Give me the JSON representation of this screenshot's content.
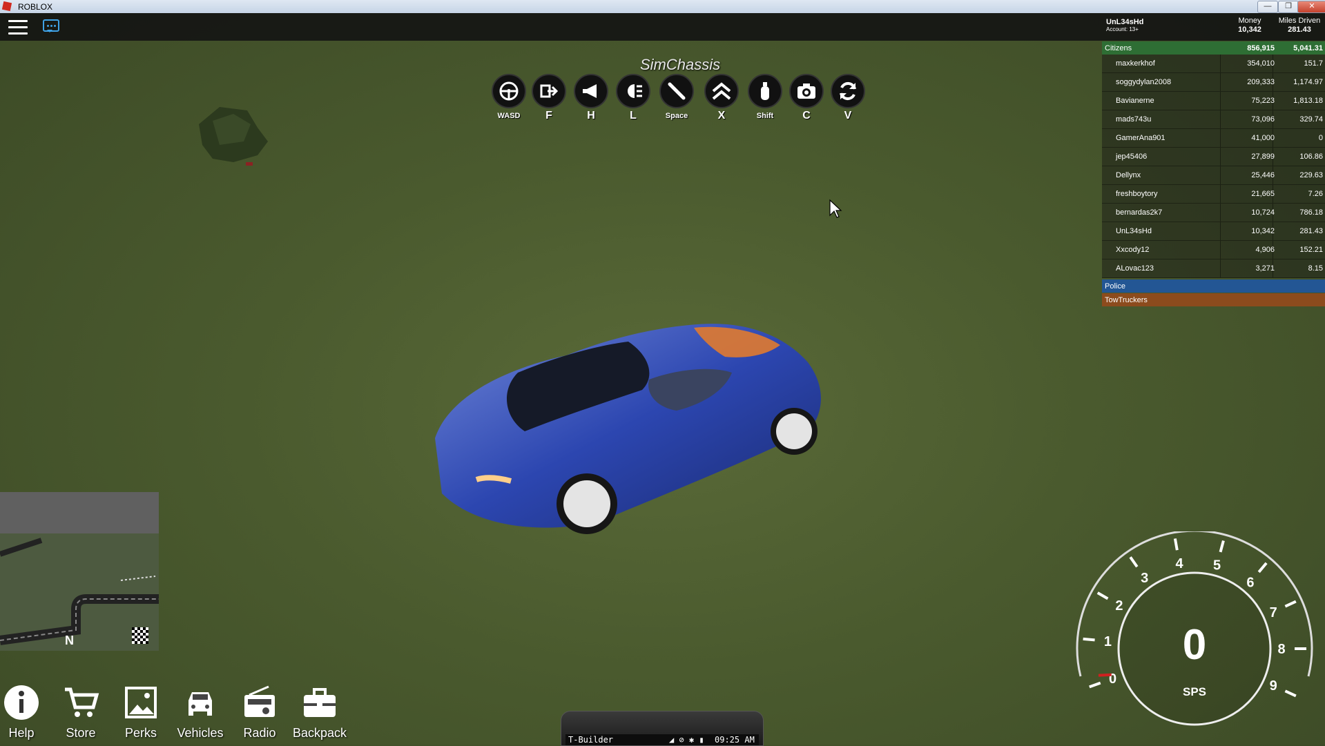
{
  "window": {
    "title": "ROBLOX",
    "min_label": "—",
    "max_label": "❐",
    "close_label": "✕"
  },
  "account": {
    "username": "UnL34sHd",
    "account_label": "Account: 13+"
  },
  "stats": {
    "money_label": "Money",
    "money_value": "10,342",
    "miles_label": "Miles Driven",
    "miles_value": "281.43"
  },
  "leaderboard": {
    "teams": [
      {
        "name": "Citizens",
        "money": "856,915",
        "miles": "5,041.31",
        "color": "#2e6e34"
      },
      {
        "name": "Police",
        "color": "#235694"
      },
      {
        "name": "TowTruckers",
        "color": "#8c4b1d"
      }
    ],
    "players": [
      {
        "name": "maxkerkhof",
        "money": "354,010",
        "miles": "151.7"
      },
      {
        "name": "soggydylan2008",
        "money": "209,333",
        "miles": "1,174.97"
      },
      {
        "name": "Bavianerne",
        "money": "75,223",
        "miles": "1,813.18"
      },
      {
        "name": "mads743u",
        "money": "73,096",
        "miles": "329.74"
      },
      {
        "name": "GamerAna901",
        "money": "41,000",
        "miles": "0"
      },
      {
        "name": "jep45406",
        "money": "27,899",
        "miles": "106.86"
      },
      {
        "name": "Dellynx",
        "money": "25,446",
        "miles": "229.63"
      },
      {
        "name": "freshboytory",
        "money": "21,665",
        "miles": "7.26"
      },
      {
        "name": "bernardas2k7",
        "money": "10,724",
        "miles": "786.18"
      },
      {
        "name": "UnL34sHd",
        "money": "10,342",
        "miles": "281.43"
      },
      {
        "name": "Xxcody12",
        "money": "4,906",
        "miles": "152.21"
      },
      {
        "name": "ALovac123",
        "money": "3,271",
        "miles": "8.15"
      }
    ]
  },
  "chassis": {
    "title": "SimChassis",
    "controls": [
      {
        "icon": "steering-wheel-icon",
        "key": "WASD"
      },
      {
        "icon": "exit-vehicle-icon",
        "key": "F"
      },
      {
        "icon": "horn-icon",
        "key": "H"
      },
      {
        "icon": "headlight-icon",
        "key": "L"
      },
      {
        "icon": "handbrake-icon",
        "key": "Space"
      },
      {
        "icon": "chevrons-up-icon",
        "key": "X"
      },
      {
        "icon": "nitro-bottle-icon",
        "key": "Shift"
      },
      {
        "icon": "camera-icon",
        "key": "C"
      },
      {
        "icon": "refresh-icon",
        "key": "V"
      }
    ]
  },
  "minimap": {
    "north_label": "N"
  },
  "dock": [
    {
      "icon": "info-icon",
      "label": "Help"
    },
    {
      "icon": "cart-icon",
      "label": "Store"
    },
    {
      "icon": "image-icon",
      "label": "Perks"
    },
    {
      "icon": "car-icon",
      "label": "Vehicles"
    },
    {
      "icon": "radio-icon",
      "label": "Radio"
    },
    {
      "icon": "backpack-icon",
      "label": "Backpack"
    }
  ],
  "tbuilder": {
    "name": "T-Builder",
    "time": "09:25 AM"
  },
  "speedometer": {
    "speed": "0",
    "unit": "SPS",
    "ticks": [
      "0",
      "1",
      "2",
      "3",
      "4",
      "5",
      "6",
      "7",
      "8",
      "9"
    ],
    "value": 0
  }
}
